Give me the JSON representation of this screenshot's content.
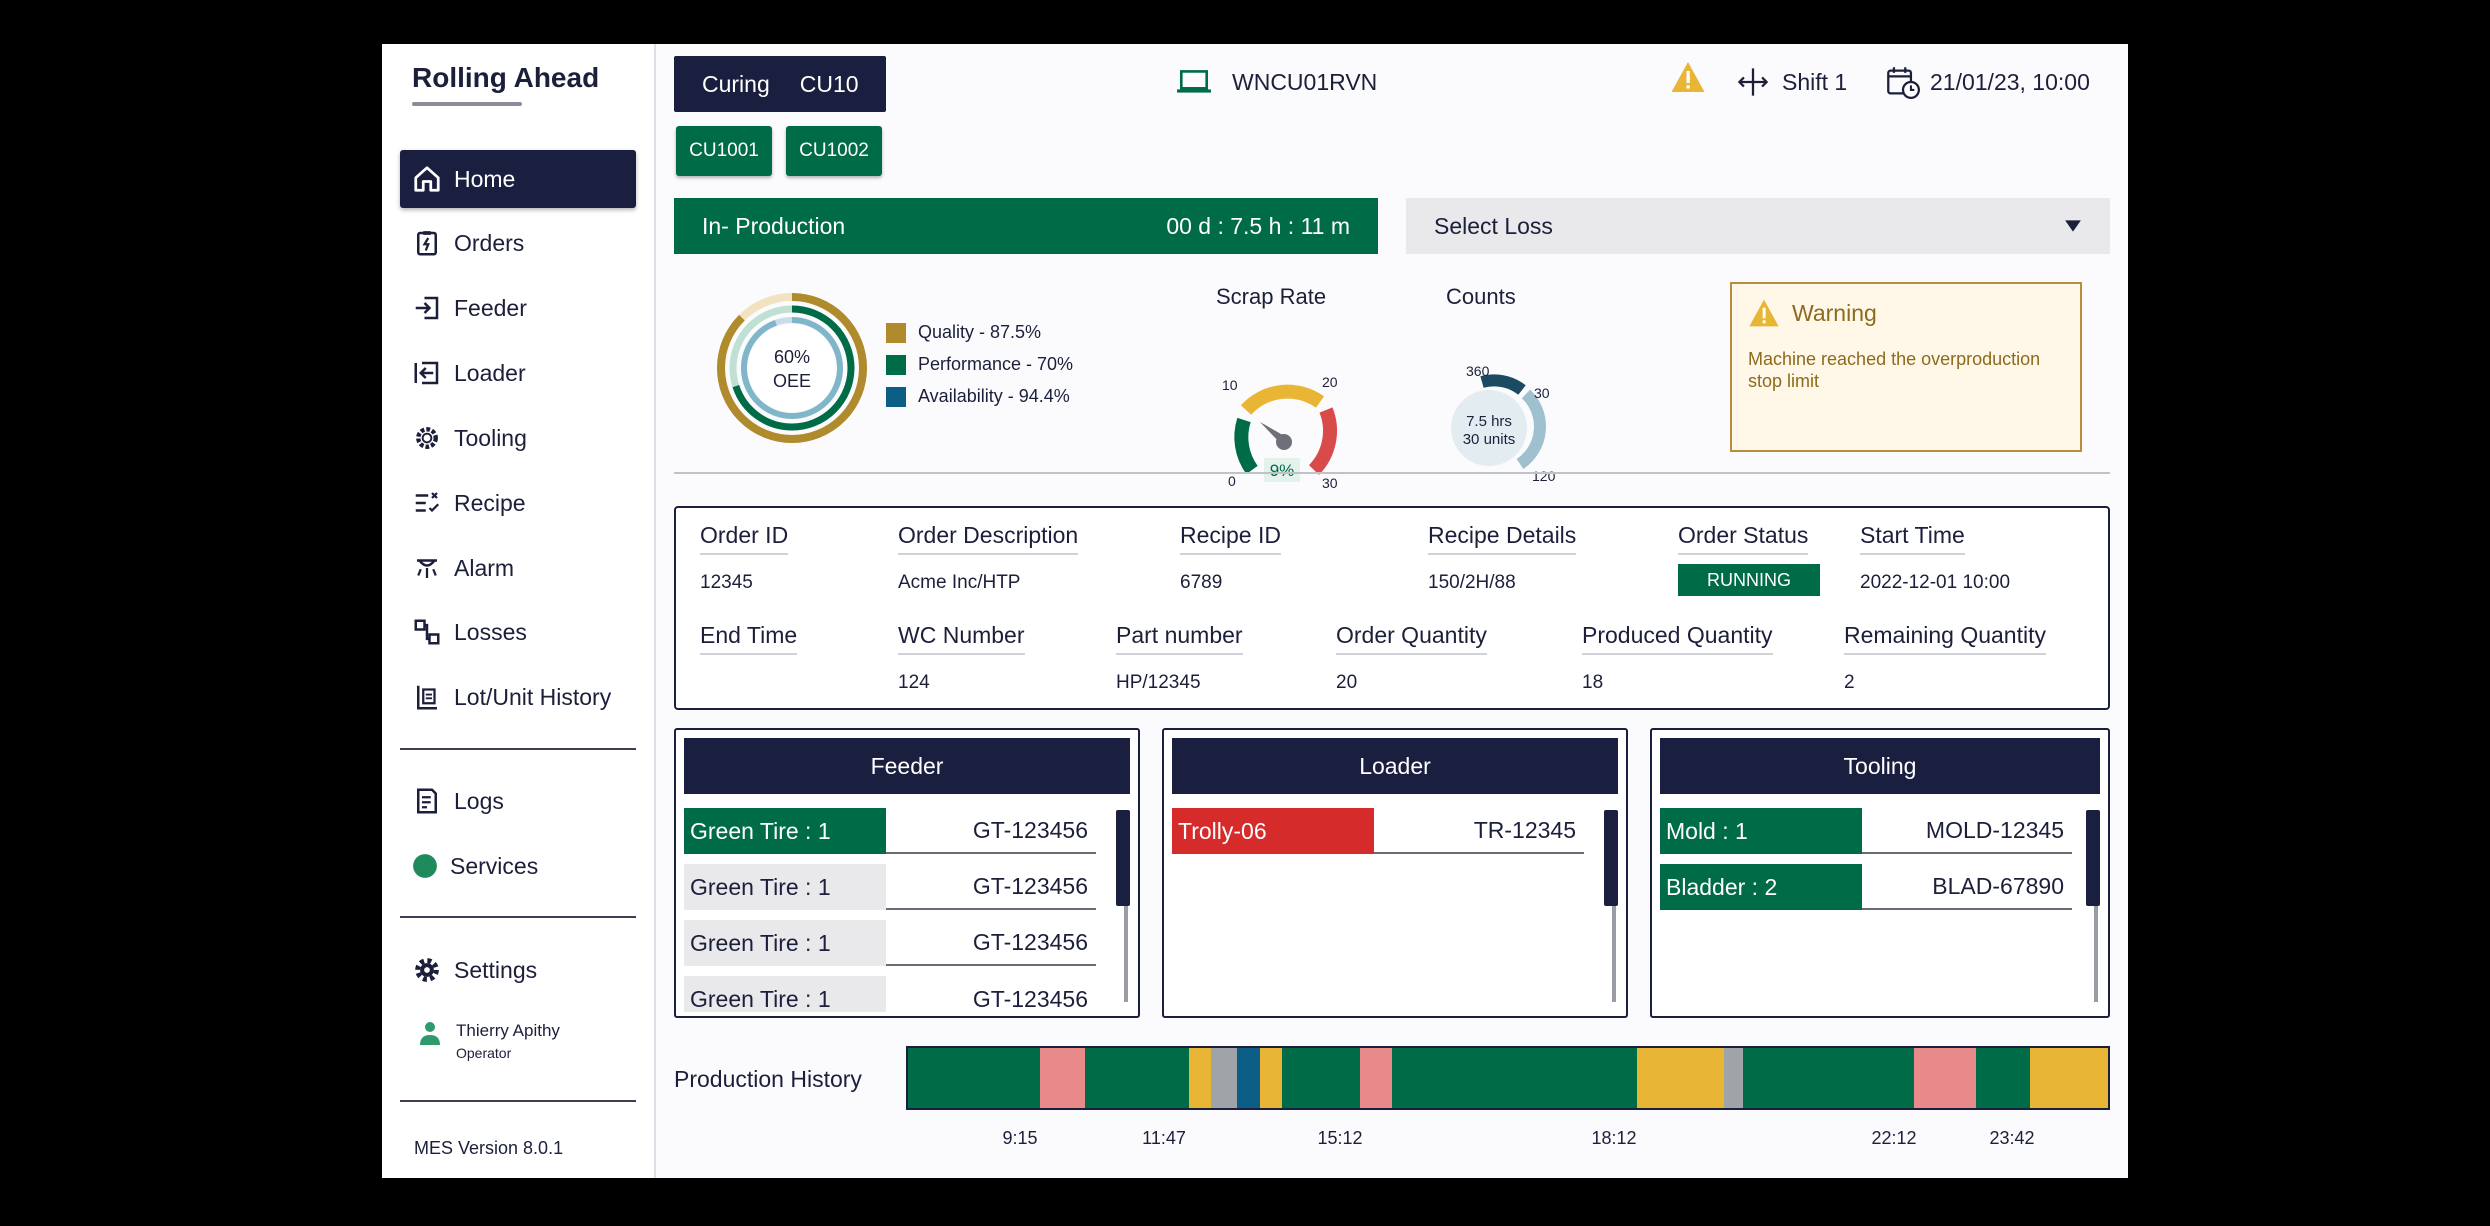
{
  "app": {
    "brand": "Rolling Ahead",
    "version": "MES Version 8.0.1"
  },
  "sidebar": {
    "items": [
      {
        "label": "Home",
        "icon": "home-icon",
        "active": true
      },
      {
        "label": "Orders",
        "icon": "clipboard-icon"
      },
      {
        "label": "Feeder",
        "icon": "feeder-icon"
      },
      {
        "label": "Loader",
        "icon": "loader-icon"
      },
      {
        "label": "Tooling",
        "icon": "tooling-icon"
      },
      {
        "label": "Recipe",
        "icon": "recipe-icon"
      },
      {
        "label": "Alarm",
        "icon": "alarm-icon"
      },
      {
        "label": "Losses",
        "icon": "losses-icon"
      },
      {
        "label": "Lot/Unit History",
        "icon": "history-icon"
      }
    ],
    "secondary": [
      {
        "label": "Logs",
        "icon": "logs-icon"
      },
      {
        "label": "Services",
        "icon": "status-dot-icon"
      }
    ],
    "settings_label": "Settings",
    "user": {
      "name": "Thierry Apithy",
      "role": "Operator"
    }
  },
  "header": {
    "curing_label": "Curing",
    "curing_code": "CU10",
    "sub_units": [
      "CU1001",
      "CU1002"
    ],
    "machine": "WNCU01RVN",
    "shift": "Shift 1",
    "datetime": "21/01/23, 10:00"
  },
  "production": {
    "status": "In- Production",
    "duration": "00 d :  7.5 h :  11 m",
    "loss_placeholder": "Select Loss"
  },
  "oee": {
    "value_label": "60%",
    "label": "OEE",
    "quality": 87.5,
    "performance": 70,
    "availability": 94.4,
    "legend": [
      "Quality - 87.5%",
      "Performance - 70%",
      "Availability - 94.4%"
    ],
    "colors": {
      "quality": "#b08b2e",
      "performance": "#006b47",
      "availability": "#0d5e86"
    }
  },
  "scrap": {
    "title": "Scrap Rate",
    "value": "9%",
    "ticks": [
      "0",
      "10",
      "20",
      "30"
    ]
  },
  "counts": {
    "title": "Counts",
    "hours": "7.5 hrs",
    "units": "30 units",
    "ticks": [
      "360",
      "30",
      "120"
    ]
  },
  "warning": {
    "title": "Warning",
    "message": "Machine reached the overproduction stop limit"
  },
  "order": {
    "row1": [
      {
        "label": "Order ID",
        "value": "12345"
      },
      {
        "label": "Order Description",
        "value": "Acme Inc/HTP"
      },
      {
        "label": "Recipe ID",
        "value": "6789"
      },
      {
        "label": "Recipe Details",
        "value": "150/2H/88"
      },
      {
        "label": "Order Status",
        "value": "RUNNING"
      },
      {
        "label": "Start Time",
        "value": "2022-12-01 10:00"
      }
    ],
    "row2": [
      {
        "label": "End Time",
        "value": ""
      },
      {
        "label": "WC Number",
        "value": "124"
      },
      {
        "label": "Part number",
        "value": "HP/12345"
      },
      {
        "label": "Order Quantity",
        "value": "20"
      },
      {
        "label": "Produced Quantity",
        "value": "18"
      },
      {
        "label": "Remaining Quantity",
        "value": "2"
      }
    ]
  },
  "feeder": {
    "title": "Feeder",
    "rows": [
      {
        "label": "Green Tire : 1",
        "value": "GT-123456",
        "state": "active"
      },
      {
        "label": "Green Tire : 1",
        "value": "GT-123456",
        "state": "idle"
      },
      {
        "label": "Green Tire : 1",
        "value": "GT-123456",
        "state": "idle"
      },
      {
        "label": "Green Tire : 1",
        "value": "GT-123456",
        "state": "idle"
      }
    ]
  },
  "loader": {
    "title": "Loader",
    "rows": [
      {
        "label": "Trolly-06",
        "value": "TR-12345",
        "state": "alert"
      }
    ]
  },
  "tooling": {
    "title": "Tooling",
    "rows": [
      {
        "label": "Mold : 1",
        "value": "MOLD-12345",
        "state": "active"
      },
      {
        "label": "Bladder : 2",
        "value": "BLAD-67890",
        "state": "active"
      }
    ]
  },
  "history": {
    "title": "Production History",
    "colors": {
      "run": "#006b47",
      "loss": "#e88a8a",
      "idle": "#e8b634",
      "off": "#a0a3a8",
      "setup": "#0d5e86"
    },
    "segments": [
      {
        "state": "run",
        "w": 82
      },
      {
        "state": "loss",
        "w": 28
      },
      {
        "state": "run",
        "w": 64
      },
      {
        "state": "idle",
        "w": 14
      },
      {
        "state": "off",
        "w": 16
      },
      {
        "state": "setup",
        "w": 14
      },
      {
        "state": "idle",
        "w": 14
      },
      {
        "state": "run",
        "w": 48
      },
      {
        "state": "loss",
        "w": 20
      },
      {
        "state": "run",
        "w": 152
      },
      {
        "state": "idle",
        "w": 54
      },
      {
        "state": "off",
        "w": 12
      },
      {
        "state": "run",
        "w": 106
      },
      {
        "state": "loss",
        "w": 38
      },
      {
        "state": "run",
        "w": 34
      },
      {
        "state": "idle",
        "w": 48
      }
    ],
    "labels": [
      "9:15",
      "11:47",
      "15:12",
      "18:12",
      "22:12",
      "23:42"
    ]
  }
}
